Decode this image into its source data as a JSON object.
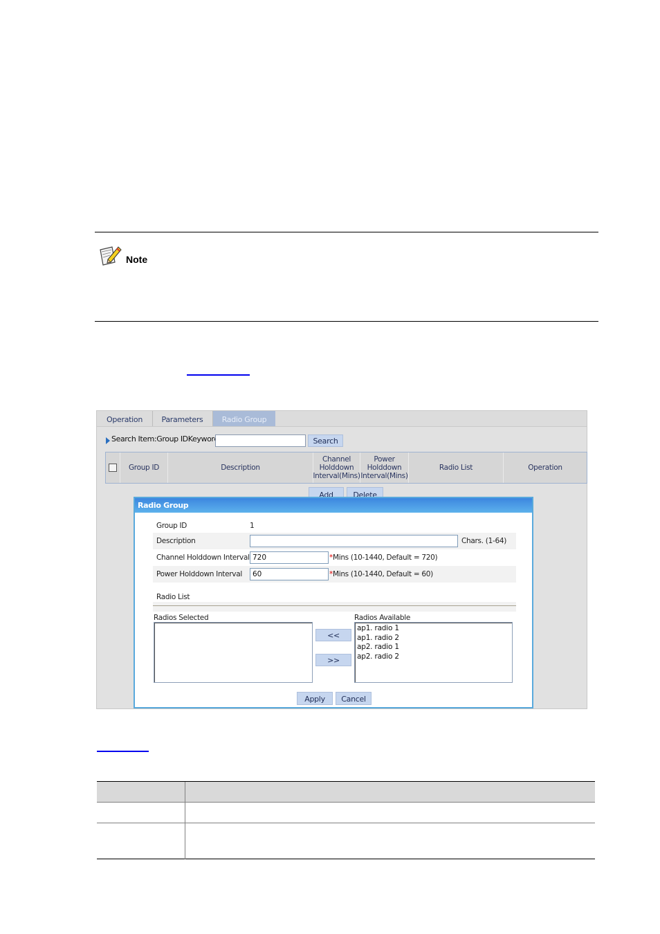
{
  "note": {
    "label": "Note"
  },
  "panel": {
    "tabs": [
      {
        "label": "Operation",
        "active": false
      },
      {
        "label": "Parameters",
        "active": false
      },
      {
        "label": "Radio Group",
        "active": true
      }
    ],
    "search": {
      "label": "Search Item:Group IDKeywords:",
      "value": "",
      "button_label": "Search"
    },
    "grid": {
      "columns": [
        "Group ID",
        "Description",
        "Channel Holddown Interval(Mins)",
        "Power Holddown Interval(Mins)",
        "Radio List",
        "Operation"
      ],
      "column_lines": {
        "channel": [
          "Channel",
          "Holddown",
          "Interval(Mins)"
        ],
        "power": [
          "Power",
          "Holddown",
          "Interval(Mins)"
        ]
      },
      "select_all_checked": false
    },
    "add_label": "Add",
    "delete_label": "Delete"
  },
  "dialog": {
    "title": "Radio Group",
    "fields": {
      "group_id": {
        "label": "Group ID",
        "value": "1"
      },
      "description": {
        "label": "Description",
        "value": "",
        "hint": "Chars. (1-64)"
      },
      "channel_holddown": {
        "label": "Channel Holddown Interval",
        "value": "720",
        "required_mark": "*",
        "hint": "Mins (10-1440, Default = 720)"
      },
      "power_holddown": {
        "label": "Power Holddown Interval",
        "value": "60",
        "required_mark": "*",
        "hint": "Mins (10-1440, Default = 60)"
      }
    },
    "radio_list_label": "Radio List",
    "radios_selected_label": "Radios Selected",
    "radios_selected": [],
    "radios_available_label": "Radios Available",
    "radios_available": [
      "ap1. radio 1",
      "ap1. radio 2",
      "ap2. radio 1",
      "ap2. radio 2"
    ],
    "move_left_label": "<<",
    "move_right_label": ">>",
    "apply_label": "Apply",
    "cancel_label": "Cancel"
  },
  "colors": {
    "dialog_title_bg": "#3c86df",
    "dialog_border": "#58a9dc",
    "button_bg": "#c6d6ef",
    "active_tab_bg": "#a9bbd8",
    "panel_bg": "#e1e1e1",
    "link": "#0000ee",
    "required": "#e00000"
  }
}
